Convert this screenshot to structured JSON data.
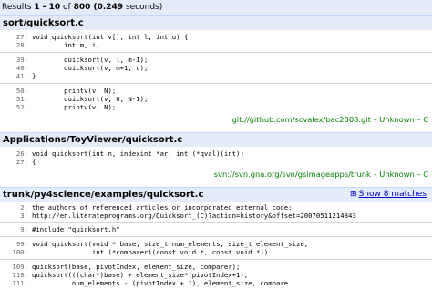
{
  "summary": {
    "prefix": "Results ",
    "range": "1 - 10",
    "of_label": " of ",
    "total": "800",
    "time": " (0.249",
    "seconds_label": " seconds)"
  },
  "results": [
    {
      "path": "sort/quicksort.c",
      "blocks": [
        [
          {
            "n": "27:",
            "code": "void quicksort(int v[], int l, int u) {"
          },
          {
            "n": "28:",
            "code": "        int m, i;"
          }
        ],
        [
          {
            "n": "39:",
            "code": "        quicksort(v, l, m-1);"
          },
          {
            "n": "40:",
            "code": "        quicksort(v, m+1, u);"
          },
          {
            "n": "41:",
            "code": "}"
          }
        ],
        [
          {
            "n": "50:",
            "code": "        printv(v, N);"
          },
          {
            "n": "51:",
            "code": "        quicksort(v, 0, N-1);"
          },
          {
            "n": "52:",
            "code": "        printv(v, N);"
          }
        ]
      ],
      "source": "git://github.com/scvalex/bac2008.git – Unknown – C"
    },
    {
      "path": "Applications/ToyViewer/quicksort.c",
      "blocks": [
        [
          {
            "n": "26:",
            "code": "void quicksort(int n, indexint *ar, int (*qval)(int))"
          },
          {
            "n": "27:",
            "code": "{"
          }
        ]
      ],
      "source": "svn://svn.gna.org/svn/gsimageapps/trunk – Unknown – C"
    },
    {
      "path": "trunk/py4science/examples/quicksort.c",
      "more": "Show 8 matches",
      "blocks": [
        [
          {
            "n": "2:",
            "code": "the authors of referenced articles or incorporated external code:"
          },
          {
            "n": "3:",
            "code": "http://en.literateprograms.org/Quicksort_(C)?action=history&offset=20070511214343"
          }
        ],
        [
          {
            "n": "9:",
            "code": "#include \"quicksort.h\""
          }
        ],
        [
          {
            "n": "99:",
            "code": "void quicksort(void * base, size_t num_elements, size_t element_size,"
          },
          {
            "n": "100:",
            "code": "               int (*comparer)(const void *, const void *))"
          }
        ],
        [
          {
            "n": "109:",
            "code": "quicksort(base, pivotIndex, element_size, comparer);"
          },
          {
            "n": "110:",
            "code": "quicksort(((char*)base) + element_size*(pivotIndex+1),"
          },
          {
            "n": "111:",
            "code": "          num_elements - (pivotIndex + 1), element_size, compare"
          }
        ]
      ]
    }
  ],
  "icons": {
    "expand": "plus-box-icon"
  },
  "colors": {
    "header_bg": "#e5ecf9",
    "source_link": "#008000",
    "link": "#0000cc"
  }
}
